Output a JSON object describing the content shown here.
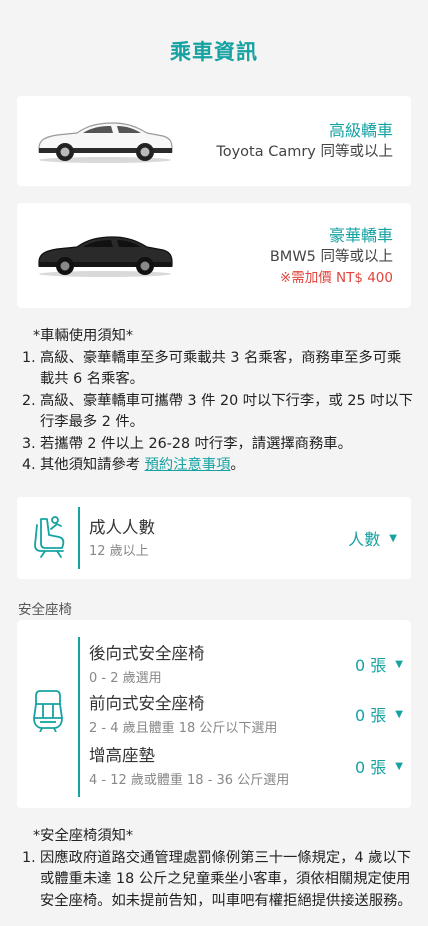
{
  "header": {
    "title": "乘車資訊"
  },
  "vehicles": [
    {
      "type": "高級轎車",
      "desc": "Toyota Camry 同等或以上",
      "surcharge": "",
      "color": "#ffffff"
    },
    {
      "type": "豪華轎車",
      "desc": "BMW5 同等或以上",
      "surcharge": "※需加價 NT$ 400",
      "color": "#2a2a2a"
    }
  ],
  "vehicle_notice": {
    "title": "*車輛使用須知*",
    "items": [
      {
        "num": "1.",
        "text": "高級、豪華轎車至多可乘載共 3 名乘客，商務車至多可乘載共 6 名乘客。"
      },
      {
        "num": "2.",
        "text": "高級、豪華轎車可攜帶 3 件 20 吋以下行李，或 25 吋以下行李最多 2 件。"
      },
      {
        "num": "3.",
        "text": "若攜帶 2 件以上 26-28 吋行李，請選擇商務車。"
      },
      {
        "num": "4.",
        "prefix": "其他須知請參考 ",
        "link": "預約注意事項",
        "suffix": "。"
      }
    ]
  },
  "adults": {
    "label": "成人人數",
    "sub": "12 歲以上",
    "value": "人數",
    "icon": "seat-person-icon"
  },
  "car_seat_section": {
    "label": "安全座椅",
    "icon": "child-car-seat-icon",
    "rows": [
      {
        "name": "後向式安全座椅",
        "note": "0 - 2 歲選用",
        "value": "0 張"
      },
      {
        "name": "前向式安全座椅",
        "note": "2 - 4 歲且體重 18 公斤以下選用",
        "value": "0 張"
      },
      {
        "name": "增高座墊",
        "note": "4 - 12 歲或體重 18 - 36 公斤選用",
        "value": "0 張"
      }
    ]
  },
  "seat_notice": {
    "title": "*安全座椅須知*",
    "items": [
      {
        "num": "1.",
        "text": "因應政府道路交通管理處罰條例第三十一條規定，4 歲以下或體重未達 18 公斤之兒童乘坐小客車，須依相關規定使用安全座椅。如未提前告知，叫車吧有權拒絕提供接送服務。"
      }
    ]
  },
  "colors": {
    "accent": "#17a2a2",
    "warning": "#e2453d",
    "background": "#f4f4f4"
  }
}
